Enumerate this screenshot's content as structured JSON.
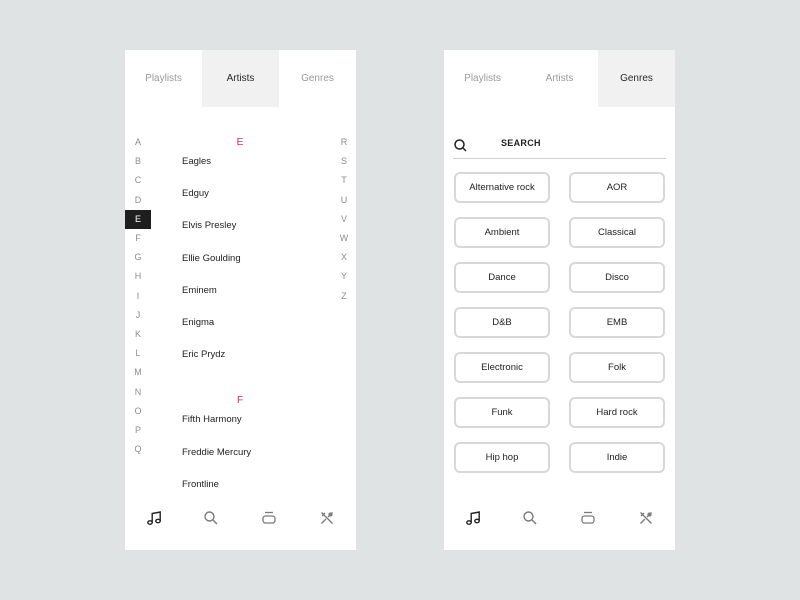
{
  "left_screen": {
    "tabs": [
      "Playlists",
      "Artists",
      "Genres"
    ],
    "active_tab": "Artists",
    "alphabet_left": [
      "A",
      "B",
      "C",
      "D",
      "E",
      "F",
      "G",
      "H",
      "I",
      "J",
      "K",
      "L",
      "M",
      "N",
      "O",
      "P",
      "Q"
    ],
    "alphabet_right": [
      "R",
      "S",
      "T",
      "U",
      "V",
      "W",
      "X",
      "Y",
      "Z"
    ],
    "active_letter": "E",
    "sections": [
      {
        "letter": "E",
        "artists": [
          "Eagles",
          "Edguy",
          "Elvis Presley",
          "Ellie Goulding",
          "Eminem",
          "Enigma",
          "Eric Prydz"
        ]
      },
      {
        "letter": "F",
        "artists": [
          "Fifth Harmony",
          "Freddie Mercury",
          "Frontline"
        ]
      }
    ]
  },
  "right_screen": {
    "tabs": [
      "Playlists",
      "Artists",
      "Genres"
    ],
    "active_tab": "Genres",
    "search": {
      "label": "SEARCH"
    },
    "genres": [
      "Alternative rock",
      "AOR",
      "Ambient",
      "Classical",
      "Dance",
      "Disco",
      "D&B",
      "EMB",
      "Electronic",
      "Folk",
      "Funk",
      "Hard rock",
      "Hip hop",
      "Indie"
    ]
  },
  "bottom_nav": {
    "icons": [
      "music-note-icon",
      "search-icon",
      "queue-icon",
      "tools-icon"
    ],
    "active": "music-note-icon"
  },
  "colors": {
    "background": "#e0e3e4",
    "accent": "#e0245e",
    "active_tab_bg": "#f1f1f1",
    "active_letter_bg": "#1e1e1e"
  }
}
